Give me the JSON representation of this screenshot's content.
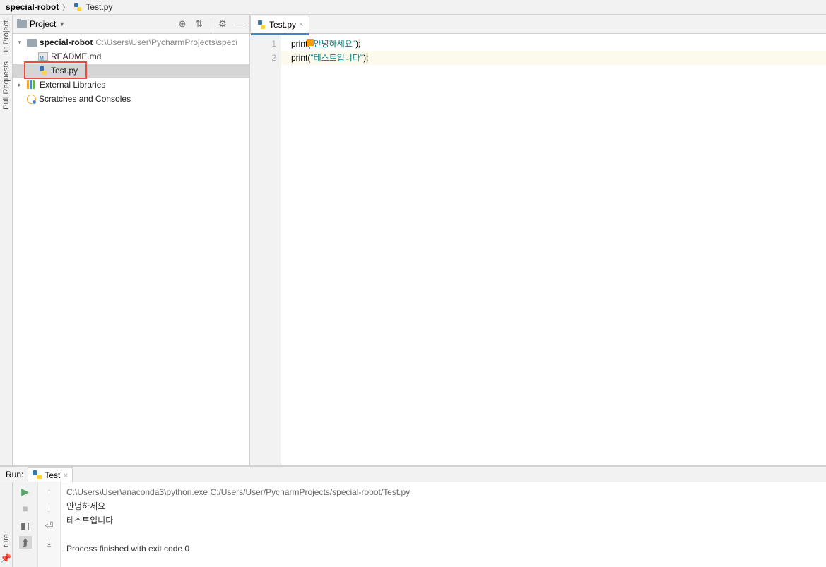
{
  "breadcrumb": {
    "project": "special-robot",
    "file": "Test.py"
  },
  "sidebar": {
    "title": "Project",
    "root": {
      "name": "special-robot",
      "path": "C:\\Users\\User\\PycharmProjects\\speci"
    },
    "files": [
      "README.md",
      "Test.py"
    ],
    "external": "External Libraries",
    "scratches": "Scratches and Consoles"
  },
  "leftGutterTabs": {
    "project": "1: Project",
    "pull": "Pull Requests"
  },
  "leftGutterBottom": {
    "structure": "ture"
  },
  "editor": {
    "tab": "Test.py",
    "lines": [
      {
        "num": "1",
        "fn": "print",
        "open": "(",
        "str": "\"안녕하세요\"",
        "close": ")",
        "semi": ";"
      },
      {
        "num": "2",
        "fn": "print",
        "open": "(",
        "str": "\"테스트입니다\"",
        "close": ")",
        "semi": ";"
      }
    ]
  },
  "run": {
    "label": "Run:",
    "config": "Test",
    "cmd": "C:\\Users\\User\\anaconda3\\python.exe C:/Users/User/PycharmProjects/special-robot/Test.py",
    "out1": "안녕하세요",
    "out2": "테스트입니다",
    "exit": "Process finished with exit code 0"
  }
}
